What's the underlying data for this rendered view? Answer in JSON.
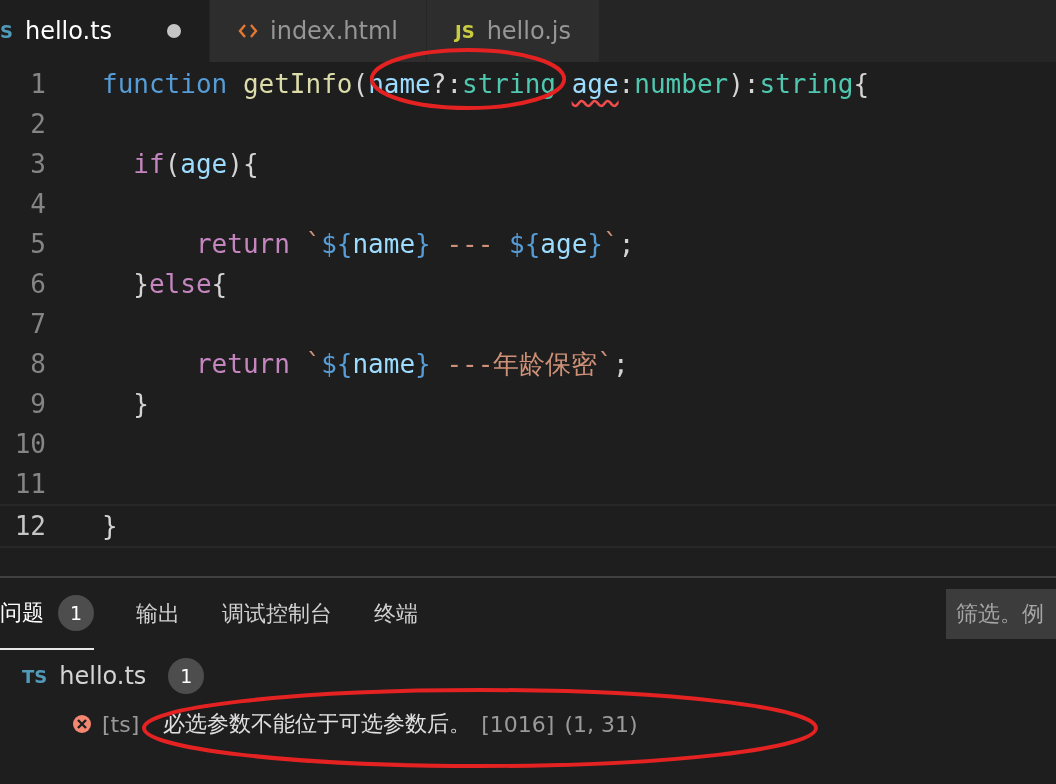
{
  "tabs": [
    {
      "kind": "ts",
      "icon_text": "S",
      "label": "hello.ts",
      "selected": true,
      "modified": true
    },
    {
      "kind": "html",
      "label": "index.html",
      "selected": false,
      "modified": false
    },
    {
      "kind": "js",
      "icon_text": "JS",
      "label": "hello.js",
      "selected": false,
      "modified": false
    }
  ],
  "editor": {
    "lines": [
      {
        "number": "1",
        "current": false,
        "tokens": [
          {
            "kind": "keyword",
            "text": "function "
          },
          {
            "kind": "function",
            "text": "getInfo"
          },
          {
            "kind": "punct",
            "text": "("
          },
          {
            "kind": "variable",
            "text": "name"
          },
          {
            "kind": "punct",
            "text": "?:"
          },
          {
            "kind": "type",
            "text": "string "
          },
          {
            "kind": "variable",
            "text": "age",
            "error": true
          },
          {
            "kind": "punct",
            "text": ":"
          },
          {
            "kind": "type",
            "text": "number"
          },
          {
            "kind": "punct",
            "text": "):"
          },
          {
            "kind": "type",
            "text": "string"
          },
          {
            "kind": "punct",
            "text": "{"
          }
        ]
      },
      {
        "number": "2",
        "current": false
      },
      {
        "number": "3",
        "current": false,
        "tokens": [
          {
            "kind": "control",
            "text": "  if"
          },
          {
            "kind": "punct",
            "text": "("
          },
          {
            "kind": "variable",
            "text": "age"
          },
          {
            "kind": "punct",
            "text": "){"
          }
        ]
      },
      {
        "number": "4",
        "current": false
      },
      {
        "number": "5",
        "current": false,
        "tokens": [
          {
            "kind": "control",
            "text": "      return "
          },
          {
            "kind": "string",
            "text": "`"
          },
          {
            "kind": "keyword",
            "text": "${"
          },
          {
            "kind": "variable",
            "text": "name"
          },
          {
            "kind": "keyword",
            "text": "}"
          },
          {
            "kind": "string",
            "text": " --- "
          },
          {
            "kind": "keyword",
            "text": "${"
          },
          {
            "kind": "variable",
            "text": "age"
          },
          {
            "kind": "keyword",
            "text": "}"
          },
          {
            "kind": "string",
            "text": "`"
          },
          {
            "kind": "punct",
            "text": ";"
          }
        ]
      },
      {
        "number": "6",
        "current": false,
        "tokens": [
          {
            "kind": "punct",
            "text": "  }"
          },
          {
            "kind": "control",
            "text": "else"
          },
          {
            "kind": "punct",
            "text": "{"
          }
        ]
      },
      {
        "number": "7",
        "current": false
      },
      {
        "number": "8",
        "current": false,
        "tokens": [
          {
            "kind": "control",
            "text": "      return "
          },
          {
            "kind": "string",
            "text": "`"
          },
          {
            "kind": "keyword",
            "text": "${"
          },
          {
            "kind": "variable",
            "text": "name"
          },
          {
            "kind": "keyword",
            "text": "}"
          },
          {
            "kind": "string",
            "text": " ---年龄保密`"
          },
          {
            "kind": "punct",
            "text": ";"
          }
        ]
      },
      {
        "number": "9",
        "current": false,
        "tokens": [
          {
            "kind": "punct",
            "text": "  }"
          }
        ]
      },
      {
        "number": "10",
        "current": false
      },
      {
        "number": "11",
        "current": false
      },
      {
        "number": "12",
        "current": true,
        "tokens": [
          {
            "kind": "punct",
            "text": "}"
          }
        ]
      }
    ]
  },
  "panel": {
    "tabs": [
      {
        "label": "问题",
        "selected": true,
        "badge": "1"
      },
      {
        "label": "输出",
        "selected": false
      },
      {
        "label": "调试控制台",
        "selected": false
      },
      {
        "label": "终端",
        "selected": false
      }
    ],
    "filter": {
      "placeholder": "筛选。例"
    },
    "problems": {
      "file_icon": "TS",
      "file": "hello.ts",
      "count": "1",
      "items": [
        {
          "kind": "error",
          "source": "[ts]",
          "message": "必选参数不能位于可选参数后。",
          "code": "[1016]",
          "position": "(1, 31)"
        }
      ]
    }
  }
}
